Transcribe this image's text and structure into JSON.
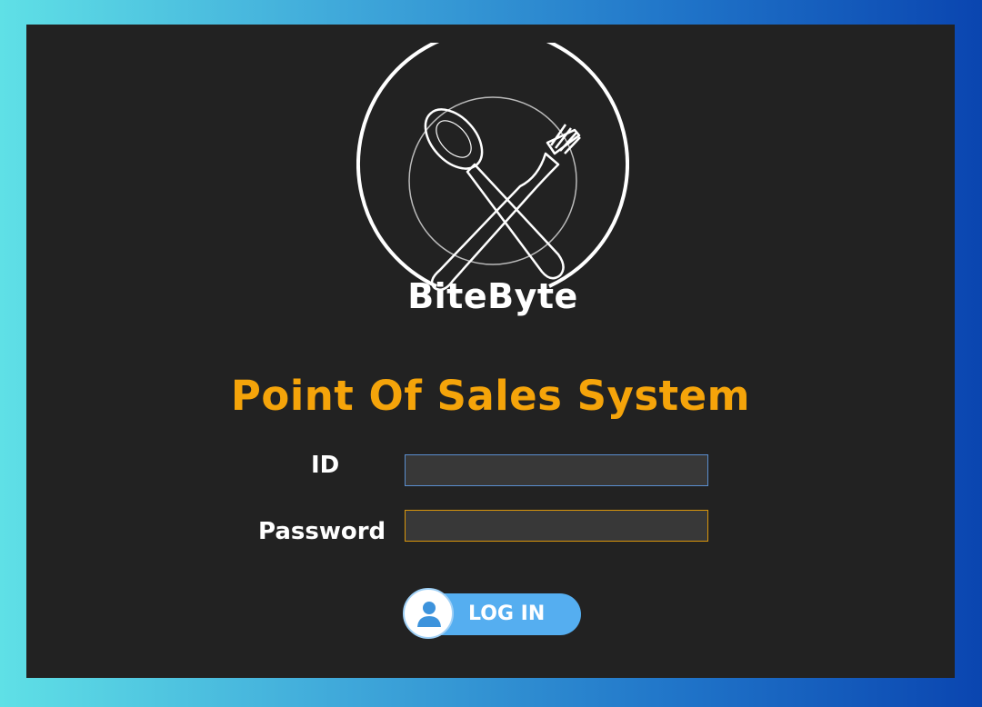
{
  "app": {
    "brand_name": "BiteByte",
    "title": "Point Of Sales System"
  },
  "form": {
    "id_label": "ID",
    "id_value": "",
    "password_label": "Password",
    "password_value": ""
  },
  "login_button": {
    "label": "LOG IN",
    "icon": "user-icon"
  },
  "colors": {
    "title": "#f5a40a",
    "panel": "#222222",
    "input_bg": "#383838",
    "id_border": "#5a8ecf",
    "password_border": "#d9960c",
    "button": "#55aef0"
  }
}
